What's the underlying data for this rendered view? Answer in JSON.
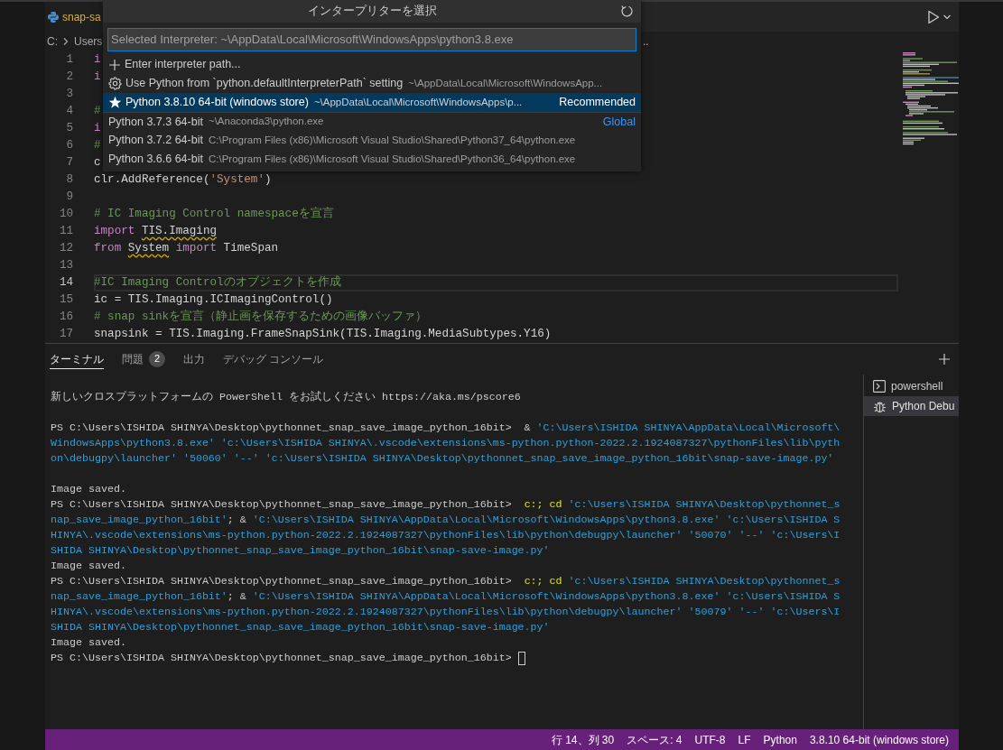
{
  "editor_tab": {
    "label": "snap-sa"
  },
  "breadcrumbs": {
    "items": [
      "C:",
      "Users"
    ],
    "tail": ".."
  },
  "interpreter_picker": {
    "title": "インタープリターを選択",
    "search": {
      "placeholder": "Selected Interpreter: ~\\AppData\\Local\\Microsoft\\WindowsApps\\python3.8.exe"
    },
    "options": [
      {
        "kind": "add",
        "label": "Enter interpreter path...",
        "selected": false
      },
      {
        "kind": "setting",
        "label": "Use Python from `python.defaultInterpreterPath` setting",
        "description": "~\\AppData\\Local\\Microsoft\\WindowsApp...",
        "selected": false
      },
      {
        "kind": "starred",
        "label": "Python 3.8.10 64-bit (windows store)",
        "description": "~\\AppData\\Local\\Microsoft\\WindowsApps\\p...",
        "tag": "Recommended",
        "selected": true
      },
      {
        "kind": "interpreter",
        "label": "Python 3.7.3 64-bit",
        "description": "~\\Anaconda3\\python.exe",
        "group_label": "Global",
        "selected": false
      },
      {
        "kind": "interpreter",
        "label": "Python 3.7.2 64-bit",
        "description": "C:\\Program Files (x86)\\Microsoft Visual Studio\\Shared\\Python37_64\\python.exe",
        "selected": false
      },
      {
        "kind": "interpreter",
        "label": "Python 3.6.6 64-bit",
        "description": "C:\\Program Files (x86)\\Microsoft Visual Studio\\Shared\\Python36_64\\python.exe",
        "selected": false
      }
    ]
  },
  "code_lines": [
    {
      "number": "1",
      "current": false,
      "tokens": [
        {
          "kind": "keyword",
          "text": "i"
        }
      ]
    },
    {
      "number": "2",
      "current": false,
      "tokens": [
        {
          "kind": "keyword",
          "text": "i"
        }
      ]
    },
    {
      "number": "3",
      "current": false
    },
    {
      "number": "4",
      "current": false,
      "tokens": [
        {
          "kind": "comment",
          "text": "#"
        }
      ]
    },
    {
      "number": "5",
      "current": false,
      "tokens": [
        {
          "kind": "keyword",
          "text": "i"
        }
      ]
    },
    {
      "number": "6",
      "current": false,
      "tokens": [
        {
          "kind": "comment",
          "text": "#"
        }
      ]
    },
    {
      "number": "7",
      "current": false,
      "tokens": [
        {
          "kind": "plain",
          "text": "c"
        }
      ]
    },
    {
      "number": "8",
      "current": false,
      "tokens": [
        {
          "kind": "plain",
          "text": "clr.AddReference("
        },
        {
          "kind": "string",
          "text": "'System'"
        },
        {
          "kind": "plain",
          "text": ")"
        }
      ]
    },
    {
      "number": "9",
      "current": false
    },
    {
      "number": "10",
      "current": false,
      "tokens": [
        {
          "kind": "comment",
          "text": "# IC Imaging Control namespaceを宣言"
        }
      ]
    },
    {
      "number": "11",
      "current": false,
      "tokens": [
        {
          "kind": "keyword",
          "text": "import "
        },
        {
          "kind": "warning",
          "text": "TIS.Imaging"
        }
      ]
    },
    {
      "number": "12",
      "current": false,
      "tokens": [
        {
          "kind": "keyword",
          "text": "from "
        },
        {
          "kind": "warning",
          "text": "System"
        },
        {
          "kind": "keyword",
          "text": " import"
        },
        {
          "kind": "plain",
          "text": " TimeSpan"
        }
      ]
    },
    {
      "number": "13",
      "current": false
    },
    {
      "number": "14",
      "current": true,
      "tokens": [
        {
          "kind": "comment",
          "text": "#IC Imaging Controlのオブジェクトを作成"
        }
      ]
    },
    {
      "number": "15",
      "current": false,
      "tokens": [
        {
          "kind": "plain",
          "text": "ic = TIS.Imaging.ICImagingControl()"
        }
      ]
    },
    {
      "number": "16",
      "current": false,
      "tokens": [
        {
          "kind": "comment",
          "text": "# snap sinkを宣言（静止画を保存するための画像バッファ）"
        }
      ]
    },
    {
      "number": "17",
      "current": false,
      "tokens": [
        {
          "kind": "plain",
          "text": "snapsink = TIS.Imaging.FrameSnapSink(TIS.Imaging.MediaSubtypes.Y16)"
        }
      ]
    }
  ],
  "panel": {
    "tabs": [
      {
        "label": "ターミナル",
        "selected": true
      },
      {
        "label": "問題",
        "badge": "2",
        "selected": false
      },
      {
        "label": "出力",
        "selected": false
      },
      {
        "label": "デバッグ コンソール",
        "selected": false
      }
    ],
    "terminal_lines": [
      {
        "kind": "text",
        "segments": [
          {
            "kind": "plain",
            "text": "新しいクロスプラットフォームの PowerShell をお試しください https://aka.ms/pscore6"
          }
        ]
      },
      {
        "kind": "blank"
      },
      {
        "kind": "text",
        "segments": [
          {
            "kind": "plain",
            "text": "PS C:\\Users\\ISHIDA SHINYA\\Desktop\\pythonnet_snap_save_image_python_16bit>  & "
          },
          {
            "kind": "string",
            "text": "'C:\\Users\\ISHIDA SHINYA\\AppData\\Local\\Microsoft\\"
          }
        ]
      },
      {
        "kind": "text",
        "segments": [
          {
            "kind": "string",
            "text": "WindowsApps\\python3.8.exe' 'c:\\Users\\ISHIDA SHINYA\\.vscode\\extensions\\ms-python.python-2022.2.1924087327\\pythonFiles\\lib\\pyth"
          }
        ]
      },
      {
        "kind": "text",
        "segments": [
          {
            "kind": "string",
            "text": "on\\debugpy\\launcher' '50060' '--' 'c:\\Users\\ISHIDA SHINYA\\Desktop\\pythonnet_snap_save_image_python_16bit\\snap-save-image.py'"
          }
        ]
      },
      {
        "kind": "blank"
      },
      {
        "kind": "text",
        "segments": [
          {
            "kind": "plain",
            "text": "Image saved."
          }
        ]
      },
      {
        "kind": "text",
        "segments": [
          {
            "kind": "plain",
            "text": "PS C:\\Users\\ISHIDA SHINYA\\Desktop\\pythonnet_snap_save_image_python_16bit>  "
          },
          {
            "kind": "command",
            "text": "c:; cd"
          },
          {
            "kind": "string",
            "text": " 'c:\\Users\\ISHIDA SHINYA\\Desktop\\pythonnet_s"
          }
        ]
      },
      {
        "kind": "text",
        "segments": [
          {
            "kind": "string",
            "text": "nap_save_image_python_16bit'"
          },
          {
            "kind": "plain",
            "text": "; & "
          },
          {
            "kind": "string",
            "text": "'C:\\Users\\ISHIDA SHINYA\\AppData\\Local\\Microsoft\\WindowsApps\\python3.8.exe' 'c:\\Users\\ISHIDA S"
          }
        ]
      },
      {
        "kind": "text",
        "segments": [
          {
            "kind": "string",
            "text": "HINYA\\.vscode\\extensions\\ms-python.python-2022.2.1924087327\\pythonFiles\\lib\\python\\debugpy\\launcher' '50070' '--' 'c:\\Users\\I"
          }
        ]
      },
      {
        "kind": "text",
        "segments": [
          {
            "kind": "string",
            "text": "SHIDA SHINYA\\Desktop\\pythonnet_snap_save_image_python_16bit\\snap-save-image.py'"
          }
        ]
      },
      {
        "kind": "text",
        "segments": [
          {
            "kind": "plain",
            "text": "Image saved."
          }
        ]
      },
      {
        "kind": "text",
        "segments": [
          {
            "kind": "plain",
            "text": "PS C:\\Users\\ISHIDA SHINYA\\Desktop\\pythonnet_snap_save_image_python_16bit>  "
          },
          {
            "kind": "command",
            "text": "c:; cd"
          },
          {
            "kind": "string",
            "text": " 'c:\\Users\\ISHIDA SHINYA\\Desktop\\pythonnet_s"
          }
        ]
      },
      {
        "kind": "text",
        "segments": [
          {
            "kind": "string",
            "text": "nap_save_image_python_16bit'"
          },
          {
            "kind": "plain",
            "text": "; & "
          },
          {
            "kind": "string",
            "text": "'C:\\Users\\ISHIDA SHINYA\\AppData\\Local\\Microsoft\\WindowsApps\\python3.8.exe' 'c:\\Users\\ISHIDA S"
          }
        ]
      },
      {
        "kind": "text",
        "segments": [
          {
            "kind": "string",
            "text": "HINYA\\.vscode\\extensions\\ms-python.python-2022.2.1924087327\\pythonFiles\\lib\\python\\debugpy\\launcher' '50079' '--' 'c:\\Users\\I"
          }
        ]
      },
      {
        "kind": "text",
        "segments": [
          {
            "kind": "string",
            "text": "SHIDA SHINYA\\Desktop\\pythonnet_snap_save_image_python_16bit\\snap-save-image.py'"
          }
        ]
      },
      {
        "kind": "text",
        "segments": [
          {
            "kind": "plain",
            "text": "Image saved."
          }
        ]
      },
      {
        "kind": "text",
        "segments": [
          {
            "kind": "plain",
            "text": "PS C:\\Users\\ISHIDA SHINYA\\Desktop\\pythonnet_snap_save_image_python_16bit> "
          },
          {
            "kind": "cursor"
          }
        ]
      }
    ],
    "terminals": [
      {
        "kind": "shell",
        "label": "powershell",
        "selected": false
      },
      {
        "kind": "debug",
        "label": "Python Debu",
        "selected": true
      }
    ]
  },
  "status_bar": {
    "items": [
      "行 14、列 30",
      "スペース: 4",
      "UTF-8",
      "LF",
      "Python",
      "3.8.10 64-bit (windows store)"
    ]
  }
}
